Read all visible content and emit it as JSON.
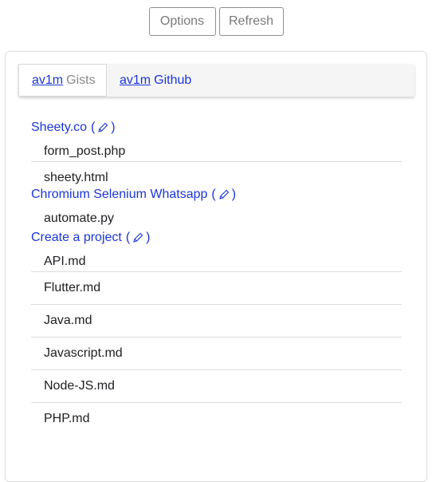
{
  "toolbar": {
    "options_label": "Options",
    "refresh_label": "Refresh"
  },
  "tabs": [
    {
      "user": "av1m",
      "label": "Gists",
      "active": true
    },
    {
      "user": "av1m",
      "label": "Github",
      "active": false
    }
  ],
  "gists": [
    {
      "title": "Sheety.co",
      "open_paren": "(",
      "close_paren": ")",
      "edit_icon": "pencil-icon",
      "files": [
        "form_post.php",
        "sheety.html"
      ]
    },
    {
      "title": "Chromium Selenium Whatsapp",
      "open_paren": "(",
      "close_paren": ")",
      "edit_icon": "pencil-icon",
      "files": [
        "automate.py"
      ]
    },
    {
      "title": "Create a project",
      "open_paren": "(",
      "close_paren": ")",
      "edit_icon": "pencil-icon",
      "files": [
        "API.md",
        "Flutter.md",
        "Java.md",
        "Javascript.md",
        "Node-JS.md",
        "PHP.md"
      ]
    }
  ],
  "colors": {
    "link": "#1a36d8",
    "text": "#202124",
    "muted": "#8a8a8a",
    "divider": "#dcdcdc"
  }
}
